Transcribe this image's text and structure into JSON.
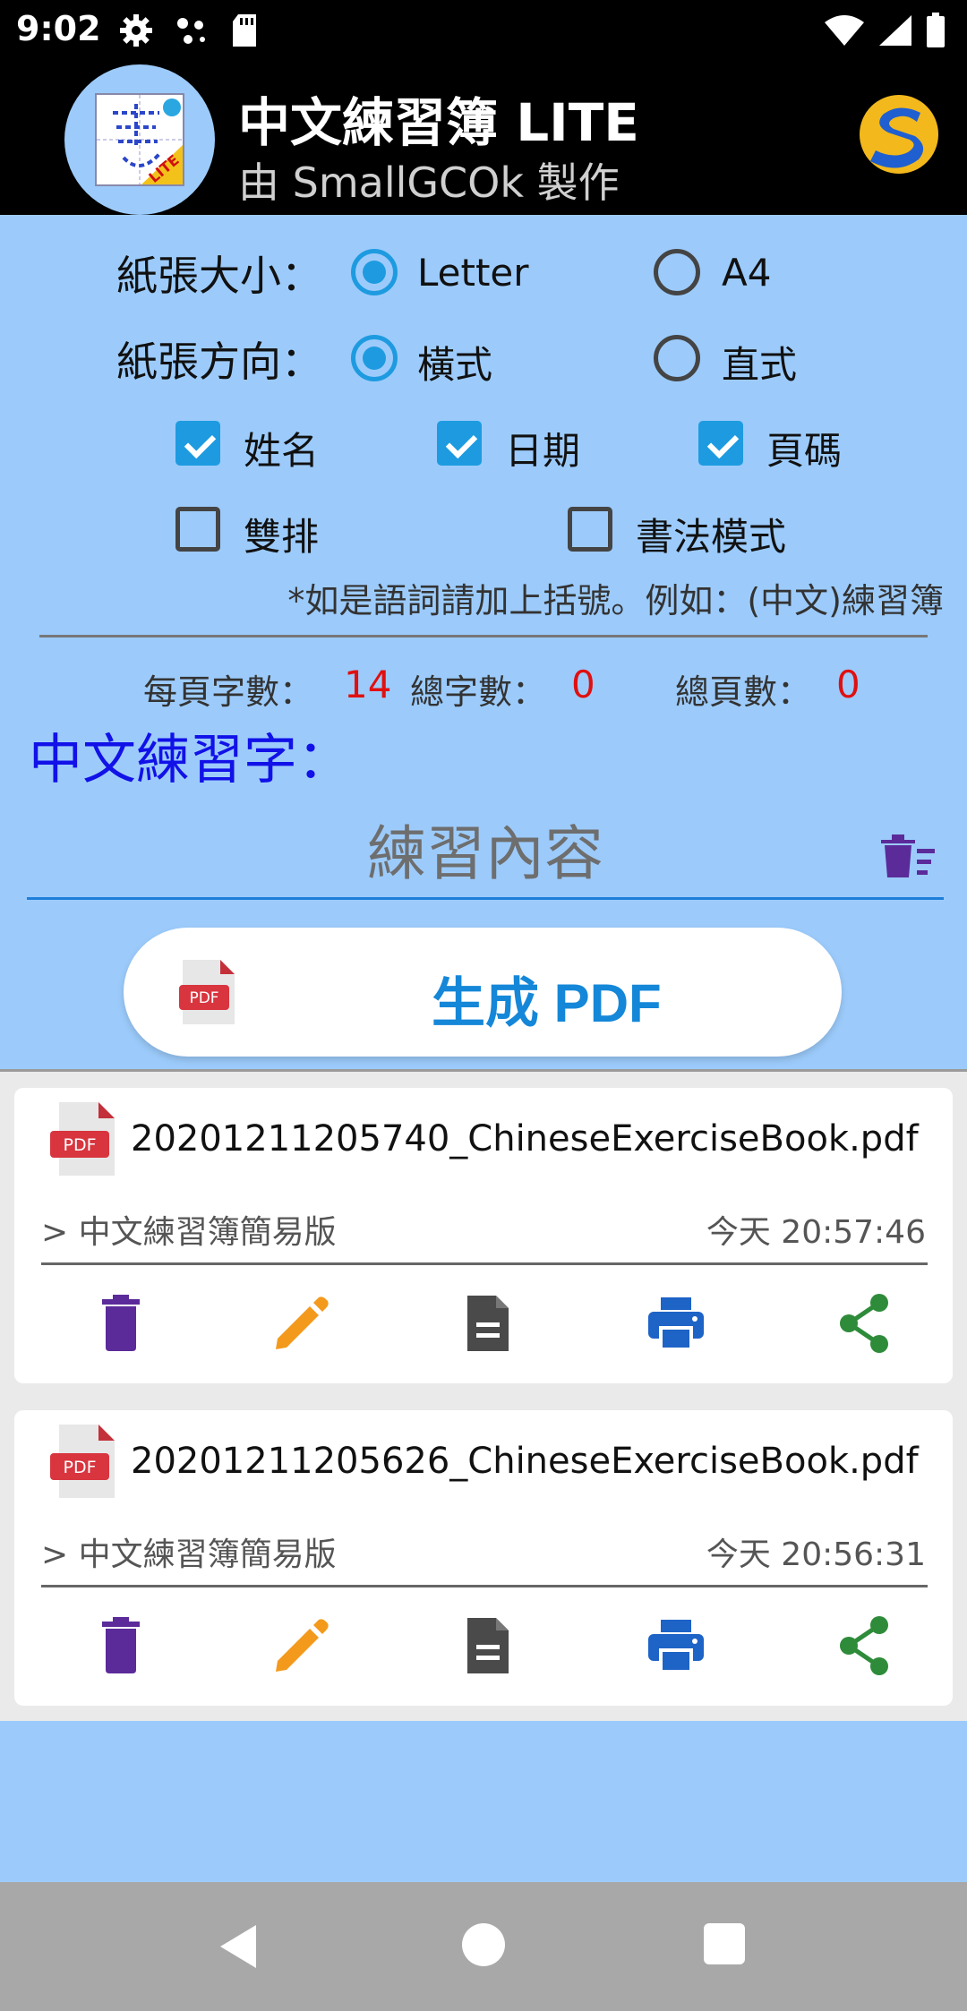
{
  "status_bar": {
    "time": "9:02"
  },
  "header": {
    "title": "中文練習簿 LITE",
    "subtitle": "由 SmallGCOk 製作",
    "logo_badge": "LITE"
  },
  "options": {
    "paper_size_label": "紙張大小：",
    "paper_size_options": [
      "Letter",
      "A4"
    ],
    "paper_size_selected": "Letter",
    "orientation_label": "紙張方向：",
    "orientation_options": [
      "橫式",
      "直式"
    ],
    "orientation_selected": "橫式",
    "checkboxes": [
      {
        "label": "姓名",
        "checked": true
      },
      {
        "label": "日期",
        "checked": true
      },
      {
        "label": "頁碼",
        "checked": true
      },
      {
        "label": "雙排",
        "checked": false
      },
      {
        "label": "書法模式",
        "checked": false
      }
    ],
    "hint": "*如是語詞請加上括號。例如：(中文)練習簿"
  },
  "stats": {
    "per_page_label": "每頁字數：",
    "per_page_value": "14",
    "total_chars_label": "總字數：",
    "total_chars_value": "0",
    "total_pages_label": "總頁數：",
    "total_pages_value": "0"
  },
  "practice": {
    "title": "中文練習字：",
    "placeholder": "練習內容",
    "value": ""
  },
  "generate_button": {
    "label": "生成 PDF",
    "icon_text": "PDF"
  },
  "files": [
    {
      "name": "20201211205740_ChineseExerciseBook.pdf",
      "path": "> 中文練習簿簡易版",
      "time": "今天 20:57:46",
      "icon_text": "PDF"
    },
    {
      "name": "20201211205626_ChineseExerciseBook.pdf",
      "path": "> 中文練習簿簡易版",
      "time": "今天 20:56:31",
      "icon_text": "PDF"
    }
  ],
  "file_actions": [
    "trash-icon",
    "pencil-icon",
    "document-icon",
    "printer-icon",
    "share-icon"
  ],
  "colors": {
    "background": "#9ccbfb",
    "accent": "#1e9be0",
    "title_blue": "#1111e8",
    "stat_red": "#e01010",
    "trash": "#5b2b9a",
    "pencil": "#f39a1c",
    "document": "#4a4a4a",
    "printer": "#1e63c6",
    "share": "#2e8b3a"
  }
}
